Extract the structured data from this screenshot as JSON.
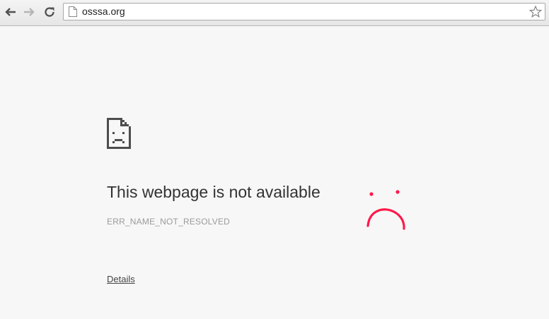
{
  "browser": {
    "url": "osssa.org",
    "colors": {
      "toolbar": "#e9e9e9",
      "page_background": "#f7f7f7"
    },
    "icons": {
      "back": "back-arrow-icon",
      "forward": "forward-arrow-icon",
      "reload": "reload-icon",
      "page": "page-icon",
      "bookmark": "star-icon"
    }
  },
  "error_page": {
    "title": "This webpage is not available",
    "code": "ERR_NAME_NOT_RESOLVED",
    "details_label": "Details",
    "icon": "sad-document-icon",
    "annotation_icon": "drawn-sad-face",
    "annotation_color": "#ff1a4a"
  }
}
